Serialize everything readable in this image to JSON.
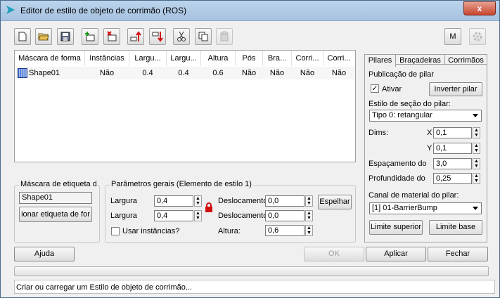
{
  "window": {
    "title": "Editor de estilo de objeto de corrimão (ROS)",
    "close_label": "x"
  },
  "toolbar": {
    "m_label": "M"
  },
  "grid": {
    "headers": [
      "Máscara de forma",
      "Instâncias",
      "Largu...",
      "Largu...",
      "Altura",
      "Pós",
      "Bra...",
      "Corri...",
      "Corri..."
    ],
    "rows": [
      [
        "Shape01",
        "Não",
        "0.4",
        "0.4",
        "0.6",
        "Não",
        "Não",
        "Não",
        "Não"
      ]
    ]
  },
  "tag_mask": {
    "title": "Máscara de etiqueta d",
    "value": "Shape01",
    "button": "ionar etiqueta de for"
  },
  "general": {
    "title": "Parâmetros gerais (Elemento de estilo 1)",
    "width1_label": "Largura",
    "width1_value": "0,4",
    "width2_label": "Largura",
    "width2_value": "0,4",
    "offset1_label": "Deslocamento",
    "offset1_value": "0,0",
    "offset2_label": "Deslocamento",
    "offset2_value": "0,0",
    "height_label": "Altura:",
    "height_value": "0,6",
    "use_instances_label": "Usar instâncias?",
    "mirror_button": "Espelhar"
  },
  "tabs": [
    "Pilares",
    "Braçadeiras",
    "Corrimãos"
  ],
  "pillars": {
    "publish_label": "Publicação de pilar",
    "active_label": "Ativar",
    "active_checked": true,
    "invert_button": "Inverter pilar",
    "section_style_label": "Estilo de seção do pilar:",
    "section_style_value": "Tipo 0: retangular",
    "dims_label": "Dims:",
    "x_label": "X",
    "x_value": "0,1",
    "y_label": "Y",
    "y_value": "0,1",
    "spacing_label": "Espaçamento do",
    "spacing_value": "3,0",
    "depth_label": "Profundidade do",
    "depth_value": "0,25",
    "material_label": "Canal de material do pilar:",
    "material_value": "[1] 01-BarrierBump",
    "upper_button": "Limite superior",
    "base_button": "Limite base"
  },
  "footer": {
    "help": "Ajuda",
    "ok": "OK",
    "apply": "Aplicar",
    "close": "Fechar",
    "status": "Criar ou carregar um Estilo de objeto de corrimão..."
  }
}
